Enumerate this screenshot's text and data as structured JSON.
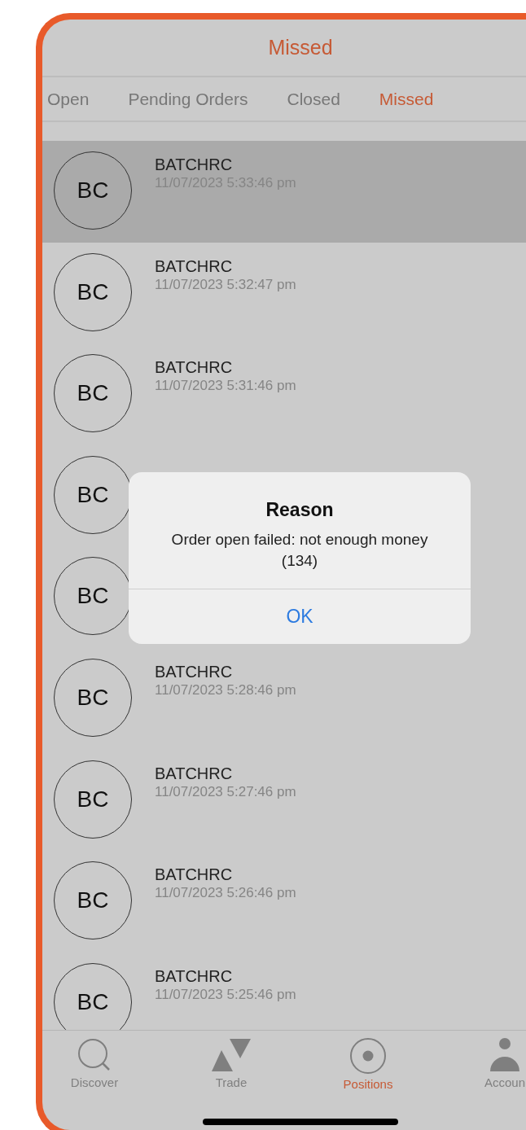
{
  "header": {
    "title": "Missed"
  },
  "tabs": [
    {
      "label": "Open",
      "selected": false
    },
    {
      "label": "Pending Orders",
      "selected": false
    },
    {
      "label": "Closed",
      "selected": false
    },
    {
      "label": "Missed",
      "selected": true
    }
  ],
  "orders": [
    {
      "initials": "BC",
      "symbol": "BATCHRC",
      "time": "11/07/2023 5:33:46 pm",
      "selected": true
    },
    {
      "initials": "BC",
      "symbol": "BATCHRC",
      "time": "11/07/2023 5:32:47 pm",
      "selected": false
    },
    {
      "initials": "BC",
      "symbol": "BATCHRC",
      "time": "11/07/2023 5:31:46 pm",
      "selected": false
    },
    {
      "initials": "BC",
      "selected": false
    },
    {
      "initials": "BC",
      "selected": false
    },
    {
      "initials": "BC",
      "symbol": "BATCHRC",
      "time": "11/07/2023 5:28:46 pm",
      "selected": false
    },
    {
      "initials": "BC",
      "symbol": "BATCHRC",
      "time": "11/07/2023 5:27:46 pm",
      "selected": false
    },
    {
      "initials": "BC",
      "symbol": "BATCHRC",
      "time": "11/07/2023 5:26:46 pm",
      "selected": false
    },
    {
      "initials": "BC",
      "symbol": "BATCHRC",
      "time": "11/07/2023 5:25:46 pm",
      "selected": false
    }
  ],
  "alert": {
    "title": "Reason",
    "message": "Order open failed: not enough money (134)",
    "button": "OK"
  },
  "tab_bar": [
    {
      "kind": "search",
      "label": "Discover",
      "selected": false
    },
    {
      "kind": "trade",
      "label": "Trade",
      "selected": false
    },
    {
      "kind": "positions",
      "label": "Positions",
      "selected": true
    },
    {
      "kind": "account",
      "label": "Accoun",
      "selected": false
    }
  ]
}
